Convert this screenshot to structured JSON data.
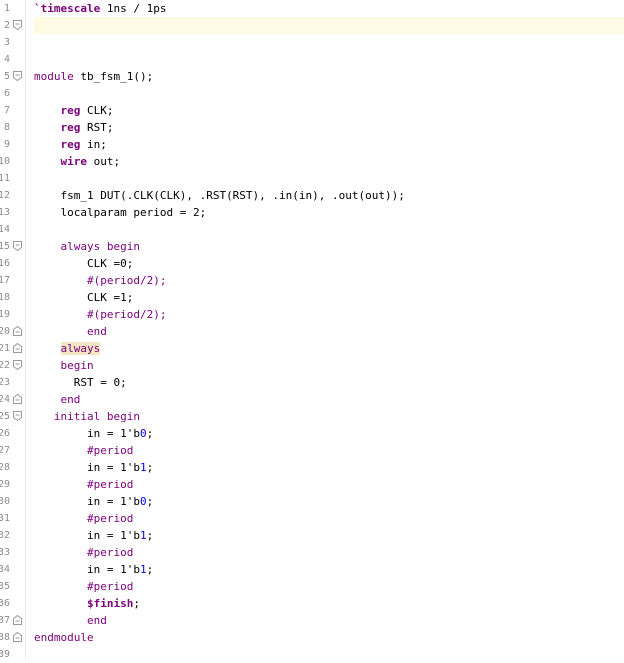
{
  "editor": {
    "lines": [
      {
        "n": "1",
        "fold": "",
        "indent": "",
        "tokens": [
          {
            "t": "`timescale",
            "c": "kwp-b"
          },
          {
            "t": " 1ns / 1ps",
            "c": ""
          }
        ]
      },
      {
        "n": "2",
        "fold": "open",
        "indent": "",
        "tokens": []
      },
      {
        "n": "3",
        "fold": "",
        "indent": "",
        "tokens": []
      },
      {
        "n": "4",
        "fold": "",
        "indent": "",
        "tokens": []
      },
      {
        "n": "5",
        "fold": "open",
        "indent": "",
        "tokens": [
          {
            "t": "module",
            "c": "kwp"
          },
          {
            "t": " tb_fsm_1();",
            "c": ""
          }
        ]
      },
      {
        "n": "6",
        "fold": "",
        "indent": "",
        "tokens": []
      },
      {
        "n": "7",
        "fold": "",
        "indent": "    ",
        "tokens": [
          {
            "t": "reg",
            "c": "kwp-b"
          },
          {
            "t": " CLK;",
            "c": ""
          }
        ]
      },
      {
        "n": "8",
        "fold": "",
        "indent": "    ",
        "tokens": [
          {
            "t": "reg",
            "c": "kwp-b"
          },
          {
            "t": " RST;",
            "c": ""
          }
        ]
      },
      {
        "n": "9",
        "fold": "",
        "indent": "    ",
        "tokens": [
          {
            "t": "reg",
            "c": "kwp-b"
          },
          {
            "t": " in;",
            "c": ""
          }
        ]
      },
      {
        "n": "10",
        "fold": "",
        "indent": "    ",
        "tokens": [
          {
            "t": "wire",
            "c": "kwp-b"
          },
          {
            "t": " out;",
            "c": ""
          }
        ]
      },
      {
        "n": "11",
        "fold": "",
        "indent": "",
        "tokens": []
      },
      {
        "n": "12",
        "fold": "",
        "indent": "    ",
        "tokens": [
          {
            "t": "fsm_1 DUT(.CLK(CLK), .RST(RST), .in(in), .out(out));",
            "c": ""
          }
        ]
      },
      {
        "n": "13",
        "fold": "",
        "indent": "    ",
        "tokens": [
          {
            "t": "localparam period = 2;",
            "c": ""
          }
        ]
      },
      {
        "n": "14",
        "fold": "",
        "indent": "",
        "tokens": []
      },
      {
        "n": "15",
        "fold": "open",
        "indent": "    ",
        "tokens": [
          {
            "t": "always",
            "c": "kwp"
          },
          {
            "t": " ",
            "c": ""
          },
          {
            "t": "begin",
            "c": "kwp"
          }
        ]
      },
      {
        "n": "16",
        "fold": "",
        "indent": "        ",
        "tokens": [
          {
            "t": "CLK =0;",
            "c": ""
          }
        ]
      },
      {
        "n": "17",
        "fold": "",
        "indent": "        ",
        "tokens": [
          {
            "t": "#(period/2);",
            "c": "kwp"
          }
        ]
      },
      {
        "n": "18",
        "fold": "",
        "indent": "        ",
        "tokens": [
          {
            "t": "CLK =1;",
            "c": ""
          }
        ]
      },
      {
        "n": "19",
        "fold": "",
        "indent": "        ",
        "tokens": [
          {
            "t": "#(period/2);",
            "c": "kwp"
          }
        ]
      },
      {
        "n": "20",
        "fold": "close",
        "indent": "        ",
        "tokens": [
          {
            "t": "end",
            "c": "kwp"
          }
        ]
      },
      {
        "n": "21",
        "fold": "close",
        "indent": "    ",
        "tokens": [
          {
            "t": "always",
            "c": "kwp word-hl"
          }
        ]
      },
      {
        "n": "22",
        "fold": "open",
        "indent": "    ",
        "tokens": [
          {
            "t": "begin",
            "c": "kwp"
          }
        ]
      },
      {
        "n": "23",
        "fold": "",
        "indent": "      ",
        "tokens": [
          {
            "t": "RST = 0;",
            "c": ""
          }
        ]
      },
      {
        "n": "24",
        "fold": "close",
        "indent": "    ",
        "tokens": [
          {
            "t": "end",
            "c": "kwp"
          }
        ]
      },
      {
        "n": "25",
        "fold": "open",
        "indent": "   ",
        "tokens": [
          {
            "t": "initial",
            "c": "kwp"
          },
          {
            "t": " ",
            "c": ""
          },
          {
            "t": "begin",
            "c": "kwp"
          }
        ]
      },
      {
        "n": "26",
        "fold": "",
        "indent": "        ",
        "tokens": [
          {
            "t": "in = 1'b",
            "c": ""
          },
          {
            "t": "0",
            "c": "num"
          },
          {
            "t": ";",
            "c": ""
          }
        ]
      },
      {
        "n": "27",
        "fold": "",
        "indent": "        ",
        "tokens": [
          {
            "t": "#period",
            "c": "kwp"
          }
        ]
      },
      {
        "n": "28",
        "fold": "",
        "indent": "        ",
        "tokens": [
          {
            "t": "in = 1'b",
            "c": ""
          },
          {
            "t": "1",
            "c": "num"
          },
          {
            "t": ";",
            "c": ""
          }
        ]
      },
      {
        "n": "29",
        "fold": "",
        "indent": "        ",
        "tokens": [
          {
            "t": "#period",
            "c": "kwp"
          }
        ]
      },
      {
        "n": "30",
        "fold": "",
        "indent": "        ",
        "tokens": [
          {
            "t": "in = 1'b",
            "c": ""
          },
          {
            "t": "0",
            "c": "num"
          },
          {
            "t": ";",
            "c": ""
          }
        ]
      },
      {
        "n": "31",
        "fold": "",
        "indent": "        ",
        "tokens": [
          {
            "t": "#period",
            "c": "kwp"
          }
        ]
      },
      {
        "n": "32",
        "fold": "",
        "indent": "        ",
        "tokens": [
          {
            "t": "in = 1'b",
            "c": ""
          },
          {
            "t": "1",
            "c": "num"
          },
          {
            "t": ";",
            "c": ""
          }
        ]
      },
      {
        "n": "33",
        "fold": "",
        "indent": "        ",
        "tokens": [
          {
            "t": "#period",
            "c": "kwp"
          }
        ]
      },
      {
        "n": "34",
        "fold": "",
        "indent": "        ",
        "tokens": [
          {
            "t": "in = 1'b",
            "c": ""
          },
          {
            "t": "1",
            "c": "num"
          },
          {
            "t": ";",
            "c": ""
          }
        ]
      },
      {
        "n": "35",
        "fold": "",
        "indent": "        ",
        "tokens": [
          {
            "t": "#period",
            "c": "kwp"
          }
        ]
      },
      {
        "n": "36",
        "fold": "",
        "indent": "        ",
        "tokens": [
          {
            "t": "$finish",
            "c": "kwp-b"
          },
          {
            "t": ";",
            "c": ""
          }
        ]
      },
      {
        "n": "37",
        "fold": "close",
        "indent": "        ",
        "tokens": [
          {
            "t": "end",
            "c": "kwp"
          }
        ]
      },
      {
        "n": "38",
        "fold": "close",
        "indent": "",
        "tokens": [
          {
            "t": "endmodule",
            "c": "kwp"
          }
        ]
      },
      {
        "n": "39",
        "fold": "",
        "indent": "",
        "tokens": []
      }
    ]
  },
  "colors": {
    "keyword": "#7a007a",
    "number": "#0000ff",
    "line_number": "#8c8c8c",
    "current_line": "#fffae3",
    "word_highlight": "#f2e7c2"
  }
}
